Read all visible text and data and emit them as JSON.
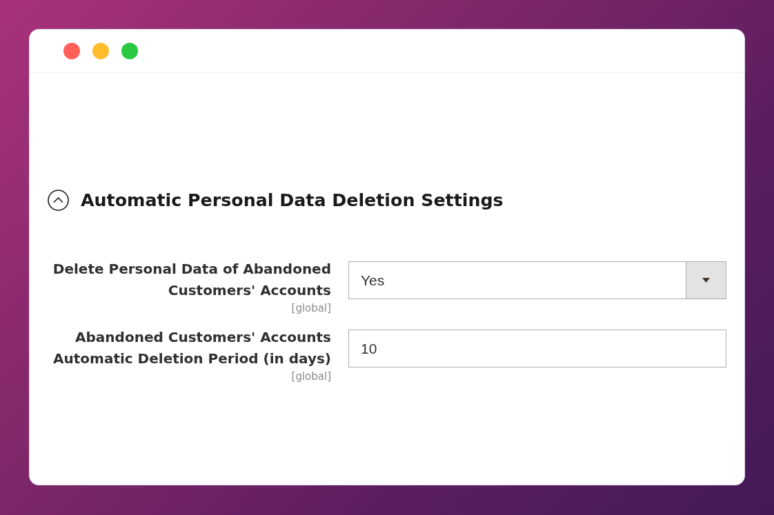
{
  "window": {
    "controls": [
      {
        "color": "#ff5f57"
      },
      {
        "color": "#ffbd2e"
      },
      {
        "color": "#28c840"
      }
    ]
  },
  "section": {
    "title": "Automatic Personal Data Deletion Settings",
    "expanded": true,
    "fields": [
      {
        "kind": "select",
        "label": "Delete Personal Data of Abandoned Customers' Accounts",
        "scope": "[global]",
        "value": "Yes"
      },
      {
        "kind": "text",
        "label": "Abandoned Customers' Accounts Automatic Deletion Period (in days)",
        "scope": "[global]",
        "value": "10"
      }
    ]
  }
}
